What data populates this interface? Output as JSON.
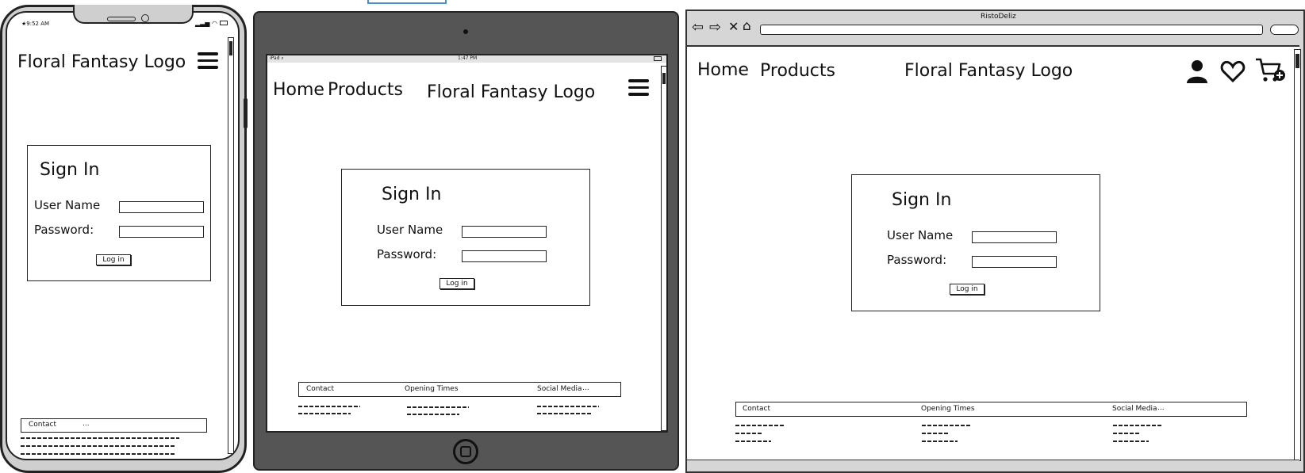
{
  "brand": {
    "logo_text": "Floral Fantasy Logo"
  },
  "nav": {
    "home": "Home",
    "products": "Products"
  },
  "signin": {
    "title": "Sign In",
    "username_label": "User Name",
    "password_label": "Password:",
    "login_button": "Log in"
  },
  "footer": {
    "contact": "Contact",
    "opening_times": "Opening Times",
    "social_media": "Social Media",
    "more": "...",
    "mobile_contact": "Contact",
    "mobile_more": "..."
  },
  "phone": {
    "status_time": "★9:52 AM"
  },
  "tablet": {
    "status_left": "iPad ⌕",
    "status_time": "1:47 PM"
  },
  "browser": {
    "window_title": "RistoDeliz"
  },
  "icons": {
    "hamburger": "hamburger-menu-icon",
    "user": "user-icon",
    "heart": "heart-icon",
    "cart": "cart-add-icon"
  }
}
